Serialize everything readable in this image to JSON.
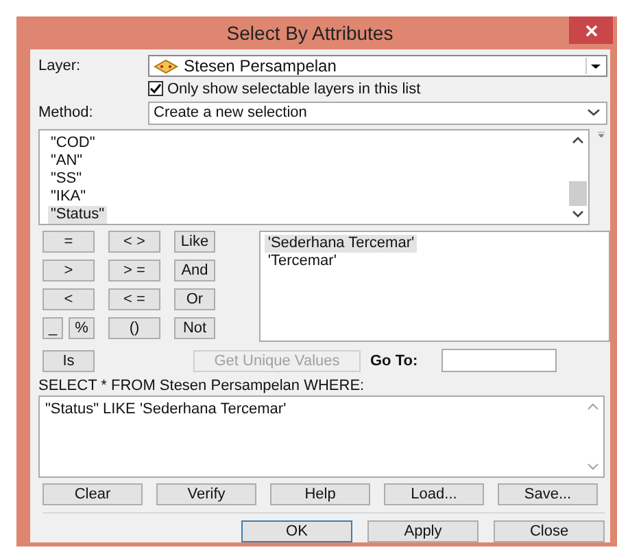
{
  "window": {
    "title": "Select By Attributes"
  },
  "layer": {
    "label": "Layer:",
    "value": "Stesen Persampelan"
  },
  "only_selectable": {
    "label": "Only show selectable layers in this list",
    "checked": true
  },
  "method": {
    "label": "Method:",
    "value": "Create a new selection"
  },
  "fields": [
    {
      "label": "\"COD\"",
      "selected": false
    },
    {
      "label": "\"AN\"",
      "selected": false
    },
    {
      "label": "\"SS\"",
      "selected": false
    },
    {
      "label": "\"IKA\"",
      "selected": false
    },
    {
      "label": "\"Status\"",
      "selected": true
    }
  ],
  "operators": [
    [
      {
        "label": "=",
        "kind": "full"
      },
      {
        "label": "< >",
        "kind": "full"
      },
      {
        "label": "Like",
        "kind": "full"
      }
    ],
    [
      {
        "label": ">",
        "kind": "full"
      },
      {
        "label": "> =",
        "kind": "full"
      },
      {
        "label": "And",
        "kind": "full"
      }
    ],
    [
      {
        "label": "<",
        "kind": "full"
      },
      {
        "label": "< =",
        "kind": "full"
      },
      {
        "label": "Or",
        "kind": "full"
      }
    ],
    [
      {
        "label": "_",
        "kind": "half"
      },
      {
        "label": "%",
        "kind": "half"
      },
      {
        "label": "()",
        "kind": "full"
      },
      {
        "label": "Not",
        "kind": "full"
      }
    ],
    [
      {
        "label": "Is",
        "kind": "full"
      }
    ]
  ],
  "values": [
    {
      "label": "'Sederhana Tercemar'",
      "selected": true
    },
    {
      "label": "'Tercemar'",
      "selected": false
    }
  ],
  "get_unique_values": {
    "label": "Get Unique Values",
    "disabled": true
  },
  "go_to": {
    "label": "Go To:"
  },
  "query_label": "SELECT * FROM Stesen Persampelan WHERE:",
  "expression": "\"Status\" LIKE 'Sederhana Tercemar'",
  "expression_buttons": [
    "Clear",
    "Verify",
    "Help",
    "Load...",
    "Save..."
  ],
  "dialog_buttons": [
    {
      "label": "OK",
      "default": true
    },
    {
      "label": "Apply",
      "default": false
    },
    {
      "label": "Close",
      "default": false
    }
  ]
}
